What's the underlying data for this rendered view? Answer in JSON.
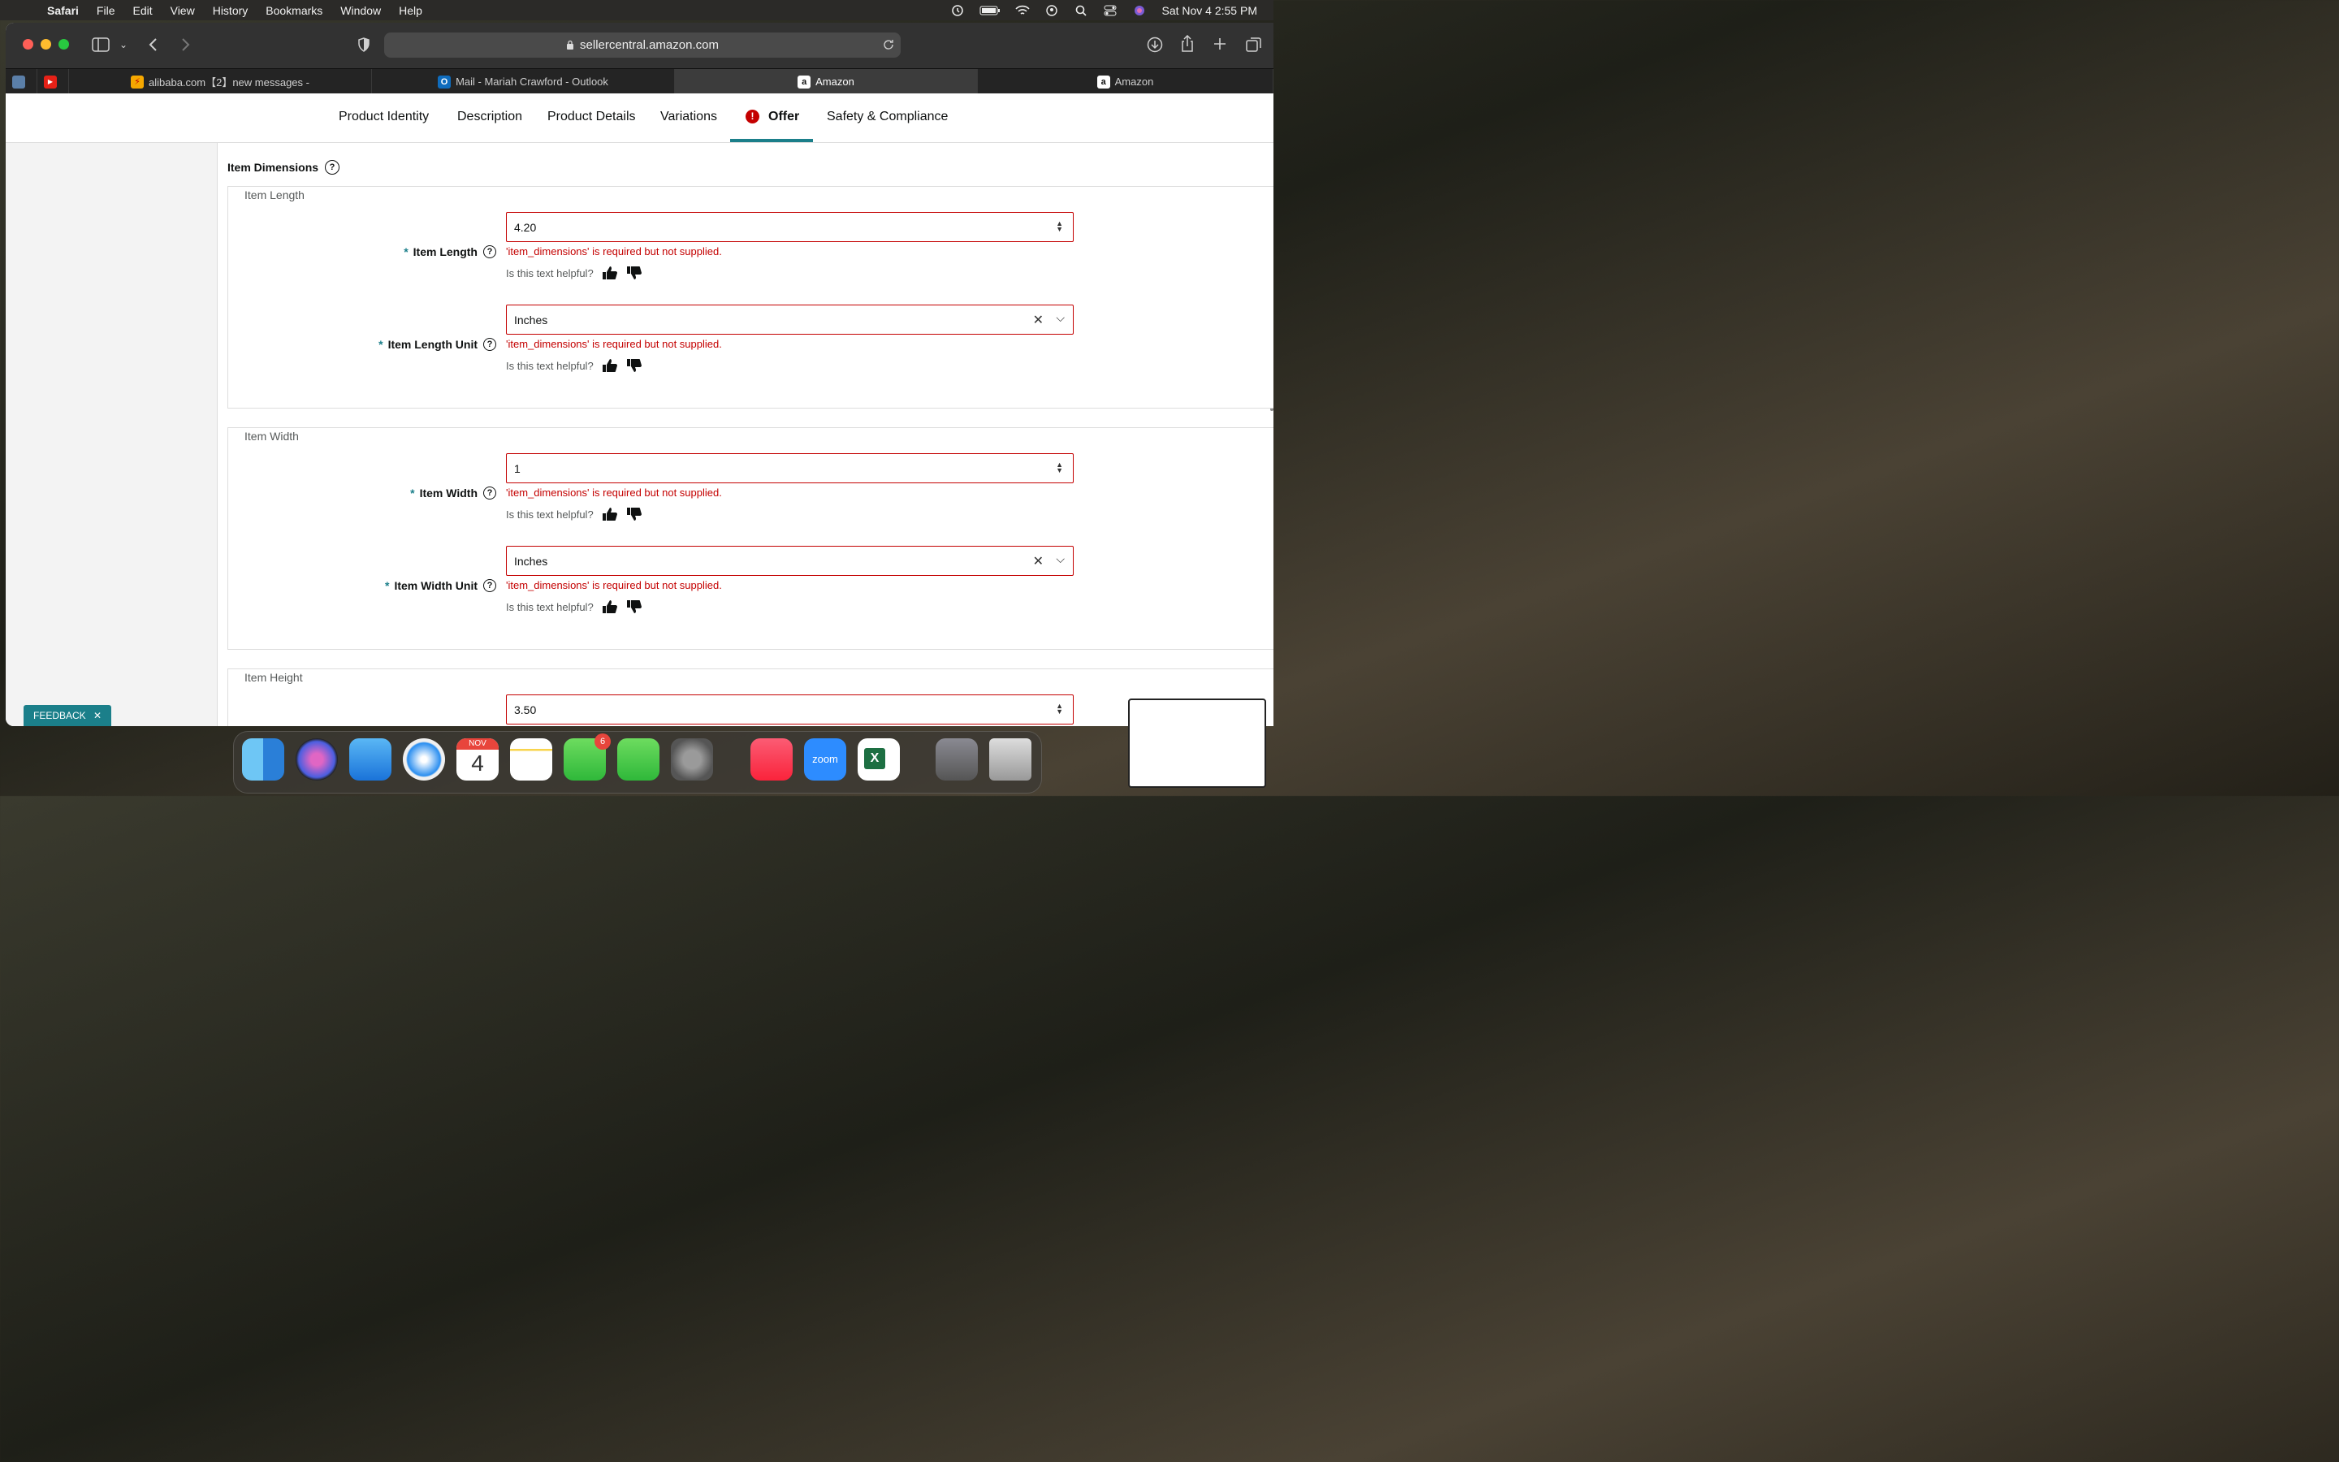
{
  "menubar": {
    "app": "Safari",
    "items": [
      "File",
      "Edit",
      "View",
      "History",
      "Bookmarks",
      "Window",
      "Help"
    ],
    "clock": "Sat Nov 4  2:55 PM"
  },
  "browser": {
    "url": "sellercentral.amazon.com",
    "tabs": [
      {
        "label": "alibaba.com【2】new messages -"
      },
      {
        "label": "Mail - Mariah Crawford - Outlook"
      },
      {
        "label": "Amazon"
      },
      {
        "label": "Amazon"
      }
    ]
  },
  "nav": {
    "tabs": [
      "Product Identity",
      "Description",
      "Product Details",
      "Variations",
      "Offer",
      "Safety & Compliance"
    ],
    "active": "Offer"
  },
  "section": {
    "title": "Item Dimensions"
  },
  "groups": [
    {
      "legend": "Item Length",
      "fields": [
        {
          "label": "Item Length",
          "value": "4.20",
          "type": "number",
          "error": "'item_dimensions' is required but not supplied.",
          "helpful": "Is this text helpful?"
        },
        {
          "label": "Item Length Unit",
          "value": "Inches",
          "type": "select",
          "error": "'item_dimensions' is required but not supplied.",
          "helpful": "Is this text helpful?"
        }
      ]
    },
    {
      "legend": "Item Width",
      "fields": [
        {
          "label": "Item Width",
          "value": "1",
          "type": "number",
          "error": "'item_dimensions' is required but not supplied.",
          "helpful": "Is this text helpful?"
        },
        {
          "label": "Item Width Unit",
          "value": "Inches",
          "type": "select",
          "error": "'item_dimensions' is required but not supplied.",
          "helpful": "Is this text helpful?"
        }
      ]
    },
    {
      "legend": "Item Height",
      "fields": [
        {
          "label": "",
          "value": "3.50",
          "type": "number"
        }
      ]
    }
  ],
  "feedback": {
    "label": "FEEDBACK"
  },
  "dock": {
    "calendar_month": "NOV",
    "calendar_day": "4",
    "messages_badge": "6",
    "zoom_label": "zoom"
  },
  "colors": {
    "accent": "#1b7f8a",
    "error": "#c40000"
  }
}
